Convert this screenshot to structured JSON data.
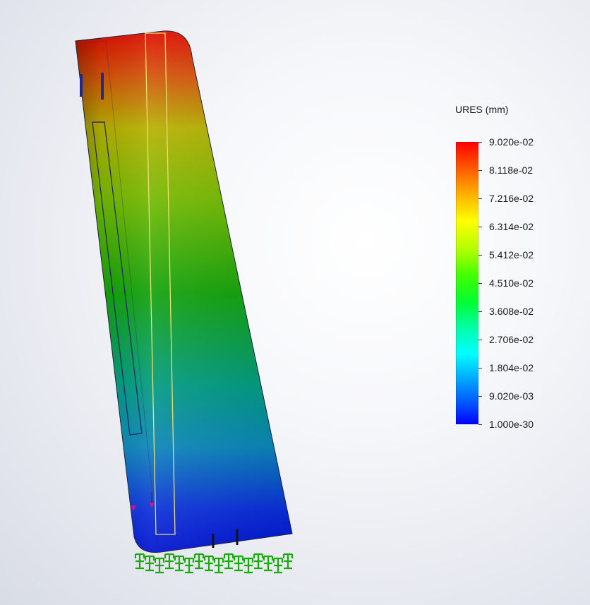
{
  "legend": {
    "title": "URES (mm)",
    "ticks": [
      "9.020e-02",
      "8.118e-02",
      "7.216e-02",
      "6.314e-02",
      "5.412e-02",
      "4.510e-02",
      "3.608e-02",
      "2.706e-02",
      "1.804e-02",
      "9.020e-03",
      "1.000e-30"
    ],
    "colors": [
      "#ff0000",
      "#ff6000",
      "#ffb400",
      "#ffff00",
      "#b4ff00",
      "#44ff00",
      "#00ff34",
      "#00ffa8",
      "#00ffff",
      "#00a8ff",
      "#0000ff"
    ]
  },
  "model": {
    "part_colors": {
      "top": "#dd1100",
      "mid": "#12a10a",
      "bottom": "#0012d0"
    },
    "fixture_color": "#1aa80a",
    "load_color": "#c0169a"
  }
}
